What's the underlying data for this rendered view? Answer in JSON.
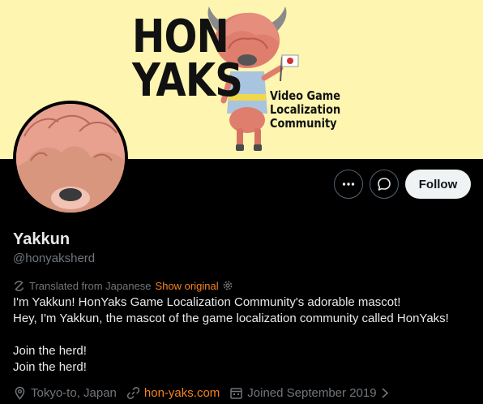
{
  "banner": {
    "logo_line1": "HON",
    "logo_line2": "YAKS",
    "tagline": [
      "Video Game",
      "Localization",
      "Community"
    ],
    "background_color": "#fdf5b0"
  },
  "actions": {
    "more_icon": "more-horizontal-icon",
    "message_icon": "message-bubble-icon",
    "follow_label": "Follow"
  },
  "profile": {
    "display_name": "Yakkun",
    "handle": "@honyaksherd"
  },
  "translation": {
    "icon": "translate-icon",
    "label": "Translated from Japanese",
    "show_original": "Show original",
    "settings_icon": "gear-icon"
  },
  "bio": {
    "lines": [
      "I'm Yakkun! HonYaks Game Localization Community's adorable mascot!",
      "Hey, I'm Yakkun, the mascot of the game localization community called HonYaks!",
      "",
      "Join the herd!",
      "Join the herd!"
    ]
  },
  "meta": {
    "location": "Tokyo-to, Japan",
    "website": "hon-yaks.com",
    "joined": "Joined September 2019"
  },
  "colors": {
    "accent": "#f5831f",
    "muted": "#71767b",
    "text": "#e7e9ea",
    "background": "#000000"
  }
}
